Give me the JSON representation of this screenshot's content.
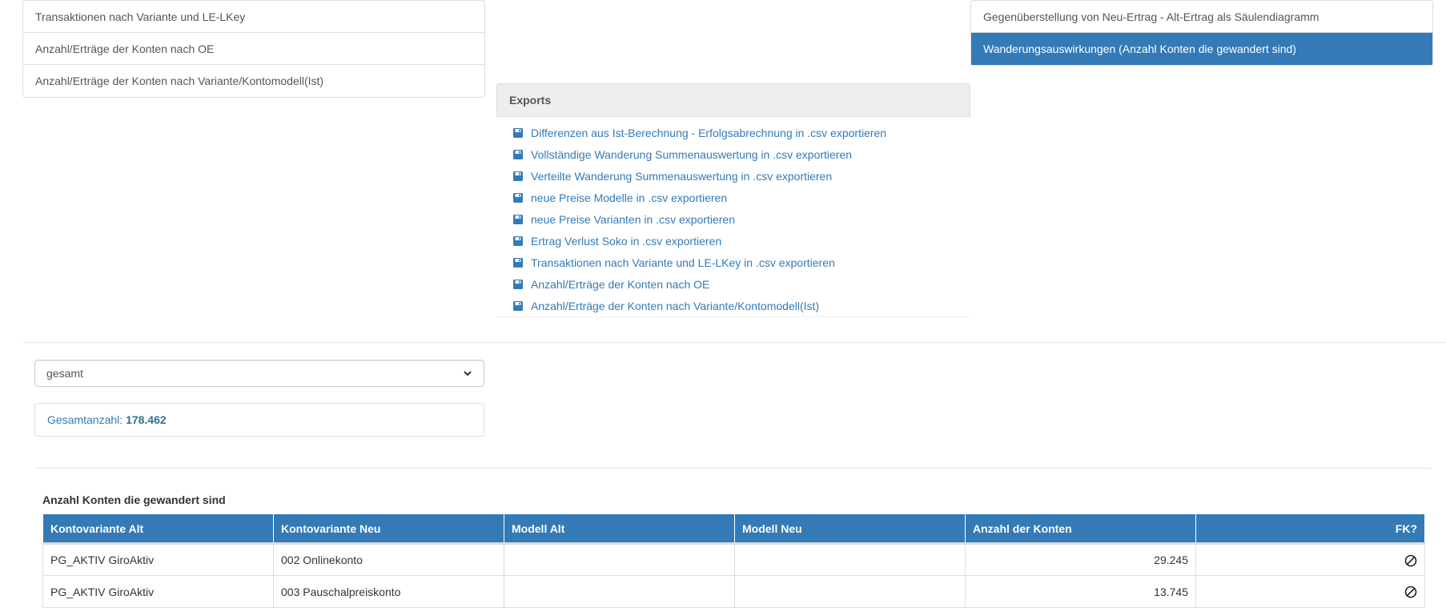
{
  "left_menu": {
    "items": [
      {
        "label": "Transaktionen nach Variante und LE-LKey"
      },
      {
        "label": "Anzahl/Erträge der Konten nach OE"
      },
      {
        "label": "Anzahl/Erträge der Konten nach Variante/Kontomodell(Ist)"
      }
    ]
  },
  "right_menu": {
    "items": [
      {
        "label": "Gegenüberstellung von Neu-Ertrag - Alt-Ertrag als Säulendiagramm",
        "active": false
      },
      {
        "label": "Wanderungsauswirkungen (Anzahl Konten die gewandert sind)",
        "active": true
      }
    ]
  },
  "exports": {
    "title": "Exports",
    "icon": "floppy-disk-icon",
    "links": [
      {
        "label": "Differenzen aus Ist-Berechnung - Erfolgsabrechnung in .csv exportieren"
      },
      {
        "label": "Vollständige Wanderung Summenauswertung in .csv exportieren"
      },
      {
        "label": "Verteilte Wanderung Summenauswertung in .csv exportieren"
      },
      {
        "label": "neue Preise Modelle in .csv exportieren"
      },
      {
        "label": "neue Preise Varianten in .csv exportieren"
      },
      {
        "label": "Ertrag Verlust Soko in .csv exportieren"
      },
      {
        "label": "Transaktionen nach Variante und LE-LKey in .csv exportieren"
      },
      {
        "label": "Anzahl/Erträge der Konten nach OE"
      },
      {
        "label": "Anzahl/Erträge der Konten nach Variante/Kontomodell(Ist)"
      }
    ]
  },
  "filter": {
    "selected": "gesamt"
  },
  "summary": {
    "label": "Gesamtanzahl:",
    "value": "178.462"
  },
  "table": {
    "title": "Anzahl Konten die gewandert sind",
    "headers": {
      "kontovariante_alt": "Kontovariante Alt",
      "kontovariante_neu": "Kontovariante Neu",
      "modell_alt": "Modell Alt",
      "modell_neu": "Modell Neu",
      "anzahl": "Anzahl der Konten",
      "fk": "FK?"
    },
    "rows": [
      {
        "kontovariante_alt": "PG_AKTIV GiroAktiv",
        "kontovariante_neu": "002 Onlinekonto",
        "modell_alt": "",
        "modell_neu": "",
        "anzahl": "29.245",
        "fk_icon": "ban-icon"
      },
      {
        "kontovariante_alt": "PG_AKTIV GiroAktiv",
        "kontovariante_neu": "003 Pauschalpreiskonto",
        "modell_alt": "",
        "modell_neu": "",
        "anzahl": "13.745",
        "fk_icon": "ban-icon"
      }
    ]
  },
  "colors": {
    "primary": "#337ab7",
    "link": "#337ab7",
    "panel_heading_bg": "#eeeeee",
    "border": "#dddddd"
  }
}
